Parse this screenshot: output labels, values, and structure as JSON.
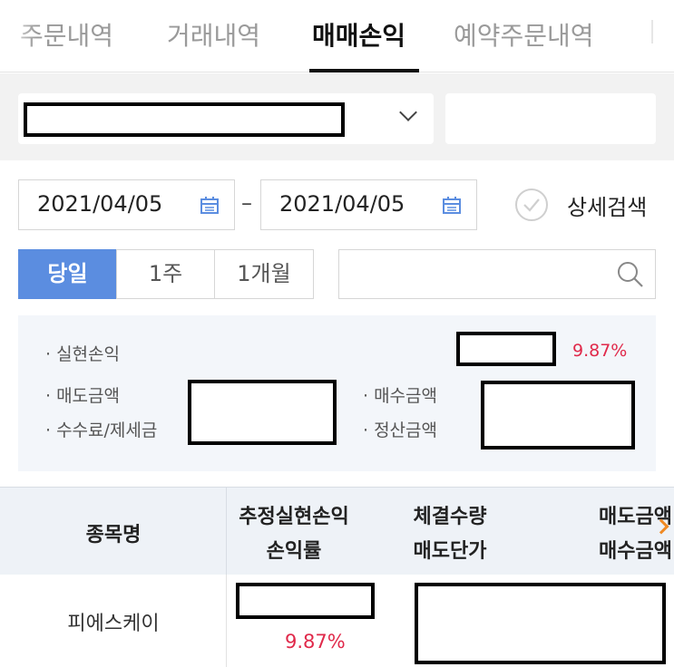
{
  "tabs": [
    {
      "label": "주문내역",
      "active": false
    },
    {
      "label": "거래내역",
      "active": false
    },
    {
      "label": "매매손익",
      "active": true
    },
    {
      "label": "예약주문내역",
      "active": false
    }
  ],
  "date_range": {
    "start": "2021/04/05",
    "end": "2021/04/05",
    "separator": "–"
  },
  "detail_search_label": "상세검색",
  "periods": [
    {
      "label": "당일",
      "active": true
    },
    {
      "label": "1주",
      "active": false
    },
    {
      "label": "1개월",
      "active": false
    }
  ],
  "summary": {
    "realized_pnl_label": "· 실현손익",
    "realized_pnl_rate": "9.87%",
    "sell_amount_label": "· 매도금액",
    "buy_amount_label": "· 매수금액",
    "fee_tax_label": "· 수수료/제세금",
    "settlement_label": "· 정산금액"
  },
  "table": {
    "headers": {
      "name": "종목명",
      "est_pnl": "추정실현손익",
      "pnl_rate": "손익률",
      "exec_qty": "체결수량",
      "sell_price": "매도단가",
      "sell_amount": "매도금액",
      "buy_amount": "매수금액"
    },
    "rows": [
      {
        "name": "피에스케이",
        "pnl_rate": "9.87%"
      }
    ]
  },
  "colors": {
    "accent": "#5b8de0",
    "loss_profit_red": "#e0294a",
    "scroll_arrow": "#f08a24"
  }
}
